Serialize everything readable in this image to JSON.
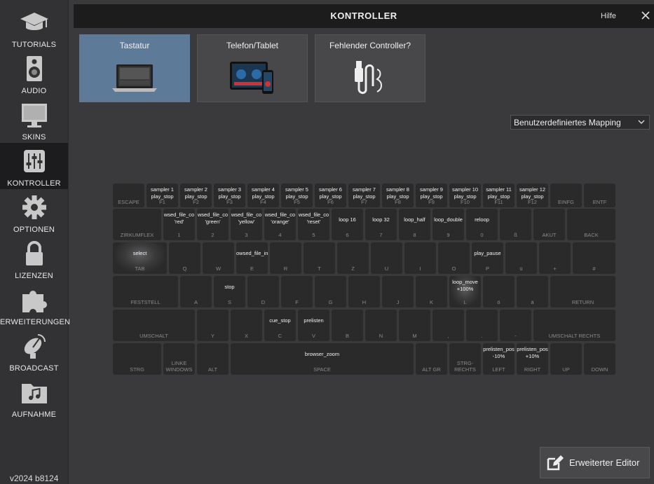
{
  "sidebar": {
    "items": [
      {
        "label": "TUTORIALS",
        "icon": "graduation-cap-icon"
      },
      {
        "label": "AUDIO",
        "icon": "speaker-icon"
      },
      {
        "label": "SKINS",
        "icon": "monitor-icon"
      },
      {
        "label": "KONTROLLER",
        "icon": "sliders-icon",
        "active": true
      },
      {
        "label": "OPTIONEN",
        "icon": "gear-icon"
      },
      {
        "label": "LIZENZEN",
        "icon": "lock-icon"
      },
      {
        "label": "ERWEITERUNGEN",
        "icon": "puzzle-icon"
      },
      {
        "label": "BROADCAST",
        "icon": "satellite-dish-icon"
      },
      {
        "label": "AUFNAHME",
        "icon": "music-folder-icon"
      }
    ],
    "version": "v2024 b8124"
  },
  "header": {
    "title": "KONTROLLER",
    "help": "Hilfe"
  },
  "tabs": [
    {
      "label": "Tastatur",
      "active": true
    },
    {
      "label": "Telefon/Tablet"
    },
    {
      "label": "Fehlender Controller?"
    }
  ],
  "mapping": {
    "selected": "Benutzerdefiniertes Mapping"
  },
  "keyboard": {
    "rows": [
      [
        {
          "label": "ESCAPE",
          "action": ""
        },
        {
          "label": "F1",
          "action": "sampler 1\nplay_stop"
        },
        {
          "label": "F2",
          "action": "sampler 2\nplay_stop"
        },
        {
          "label": "F3",
          "action": "sampler 3\nplay_stop"
        },
        {
          "label": "F4",
          "action": "sampler 4\nplay_stop"
        },
        {
          "label": "F5",
          "action": "sampler 5\nplay_stop"
        },
        {
          "label": "F6",
          "action": "sampler 6\nplay_stop"
        },
        {
          "label": "F7",
          "action": "sampler 7\nplay_stop"
        },
        {
          "label": "F8",
          "action": "sampler 8\nplay_stop"
        },
        {
          "label": "F9",
          "action": "sampler 9\nplay_stop"
        },
        {
          "label": "F10",
          "action": "sampler 10\nplay_stop"
        },
        {
          "label": "F11",
          "action": "sampler 11\nplay_stop"
        },
        {
          "label": "F12",
          "action": "sampler 12\nplay_stop"
        },
        {
          "label": "EINFG",
          "action": ""
        },
        {
          "label": "ENTF",
          "action": ""
        }
      ],
      [
        {
          "label": "ZIRKUMFLEX",
          "action": ""
        },
        {
          "label": "1",
          "action": "wsed_file_co\n'red'"
        },
        {
          "label": "2",
          "action": "wsed_file_co\n'green'"
        },
        {
          "label": "3",
          "action": "wsed_file_co\n'yellow'"
        },
        {
          "label": "4",
          "action": "wsed_file_co\n'orange'"
        },
        {
          "label": "5",
          "action": "wsed_file_co\n'reset'"
        },
        {
          "label": "6",
          "action": "loop 16"
        },
        {
          "label": "7",
          "action": "loop 32"
        },
        {
          "label": "8",
          "action": "loop_half"
        },
        {
          "label": "9",
          "action": "loop_double"
        },
        {
          "label": "0",
          "action": "reloop"
        },
        {
          "label": "ß",
          "action": ""
        },
        {
          "label": "AKUT",
          "action": ""
        },
        {
          "label": "BACK",
          "action": ""
        }
      ],
      [
        {
          "label": "TAB",
          "action": "select"
        },
        {
          "label": "Q",
          "action": ""
        },
        {
          "label": "W",
          "action": ""
        },
        {
          "label": "E",
          "action": "owsed_file_in"
        },
        {
          "label": "R",
          "action": ""
        },
        {
          "label": "T",
          "action": ""
        },
        {
          "label": "Z",
          "action": ""
        },
        {
          "label": "U",
          "action": ""
        },
        {
          "label": "I",
          "action": ""
        },
        {
          "label": "O",
          "action": ""
        },
        {
          "label": "P",
          "action": "play_pause"
        },
        {
          "label": "ü",
          "action": ""
        },
        {
          "label": "+",
          "action": ""
        },
        {
          "label": "#",
          "action": ""
        }
      ],
      [
        {
          "label": "FESTSTELL",
          "action": ""
        },
        {
          "label": "A",
          "action": ""
        },
        {
          "label": "S",
          "action": "stop"
        },
        {
          "label": "D",
          "action": ""
        },
        {
          "label": "F",
          "action": ""
        },
        {
          "label": "G",
          "action": ""
        },
        {
          "label": "H",
          "action": ""
        },
        {
          "label": "J",
          "action": ""
        },
        {
          "label": "K",
          "action": ""
        },
        {
          "label": "L",
          "action": "loop_move\n+100%"
        },
        {
          "label": "ö",
          "action": ""
        },
        {
          "label": "ä",
          "action": ""
        },
        {
          "label": "RETURN",
          "action": ""
        }
      ],
      [
        {
          "label": "UMSCHALT",
          "action": ""
        },
        {
          "label": "Y",
          "action": ""
        },
        {
          "label": "X",
          "action": ""
        },
        {
          "label": "C",
          "action": "cue_stop"
        },
        {
          "label": "V",
          "action": "prelisten"
        },
        {
          "label": "B",
          "action": ""
        },
        {
          "label": "N",
          "action": ""
        },
        {
          "label": "M",
          "action": ""
        },
        {
          "label": ",",
          "action": ""
        },
        {
          "label": ".",
          "action": ""
        },
        {
          "label": "-",
          "action": ""
        },
        {
          "label": "UMSCHALT RECHTS",
          "action": ""
        }
      ],
      [
        {
          "label": "STRG",
          "action": ""
        },
        {
          "label": "LINKE\nWINDOWS",
          "action": ""
        },
        {
          "label": "ALT",
          "action": ""
        },
        {
          "label": "SPACE",
          "action": "browser_zoom"
        },
        {
          "label": "ALT GR",
          "action": ""
        },
        {
          "label": "STRG-\nRECHTS",
          "action": ""
        },
        {
          "label": "LEFT",
          "action": "prelisten_pos\n-10%"
        },
        {
          "label": "RIGHT",
          "action": "prelisten_pos\n+10%"
        },
        {
          "label": "UP",
          "action": ""
        },
        {
          "label": "DOWN",
          "action": ""
        }
      ]
    ]
  },
  "editor_button": {
    "label": "Erweiterter Editor"
  }
}
